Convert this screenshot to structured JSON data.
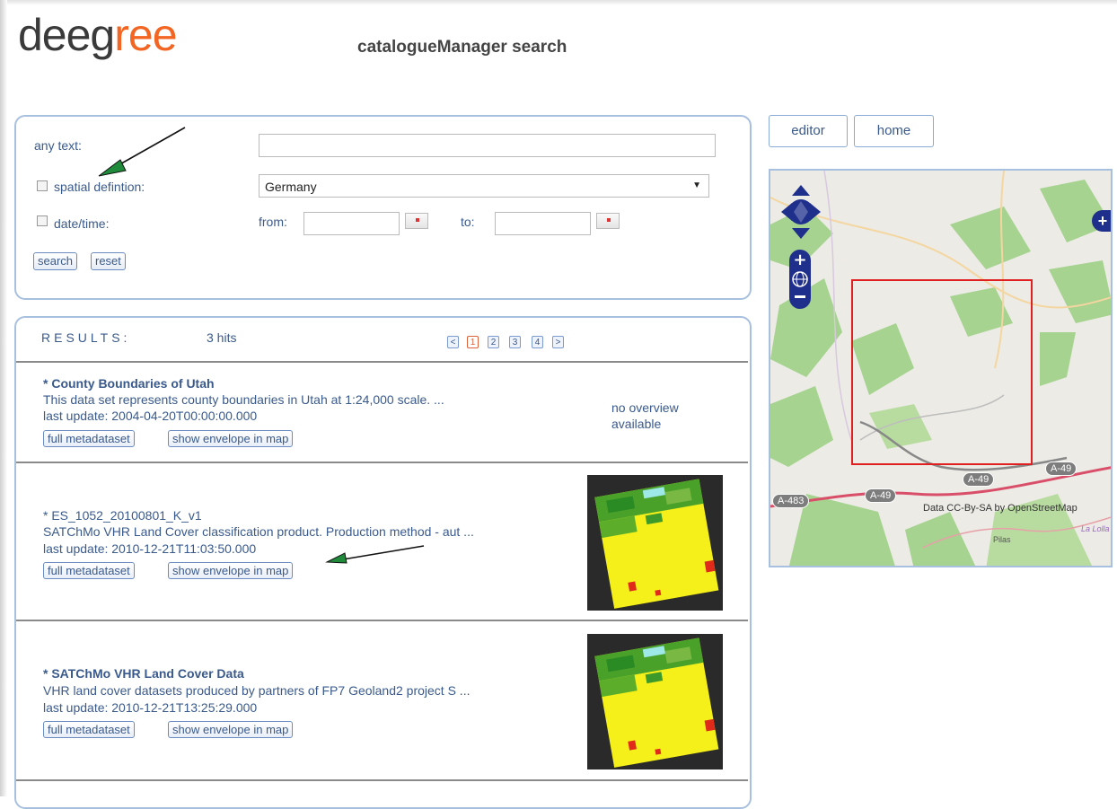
{
  "header": {
    "logo_main": "deeg",
    "logo_accent": "ree",
    "title": "catalogueManager search"
  },
  "search": {
    "any_text_label": "any text:",
    "any_text_value": "",
    "spatial_label": "spatial defintion:",
    "spatial_value": "Germany",
    "date_label": "date/time:",
    "from_label": "from:",
    "to_label": "to:",
    "search_button": "search",
    "reset_button": "reset"
  },
  "results": {
    "heading": "RESULTS:",
    "hits": "3 hits",
    "pager": {
      "prev": "<",
      "pages": [
        "1",
        "2",
        "3",
        "4"
      ],
      "next": ">",
      "active": "1"
    },
    "items": [
      {
        "title": "* County Boundaries of Utah",
        "desc": "This data set represents county boundaries in Utah at 1:24,000 scale. ...",
        "date": "last update: 2004-04-20T00:00:00.000",
        "full_btn": "full metadataset",
        "envelope_btn": "show envelope in map",
        "overview_line1": "no overview",
        "overview_line2": "available"
      },
      {
        "title": "* ES_1052_20100801_K_v1",
        "desc": "SATChMo VHR Land Cover classification product. Production method - aut ...",
        "date": "last update: 2010-12-21T11:03:50.000",
        "full_btn": "full metadataset",
        "envelope_btn": "show envelope in map"
      },
      {
        "title": "* SATChMo VHR Land Cover Data",
        "desc": "VHR land cover datasets produced by partners of FP7 Geoland2 project S ...",
        "date": "last update: 2010-12-21T13:25:29.000",
        "full_btn": "full metadataset",
        "envelope_btn": "show envelope in map"
      }
    ]
  },
  "nav": {
    "editor": "editor",
    "home": "home"
  },
  "map": {
    "attribution": "Data CC-By-SA by OpenStreetMap",
    "road_labels": [
      "A-49",
      "A-49",
      "A-49",
      "A-483"
    ],
    "place_labels": [
      "Pilas",
      "La Lolla"
    ],
    "envelope_color": "#e02020"
  },
  "colors": {
    "accent": "#f26522",
    "link": "#3a5a8c",
    "panel_border": "#a8c0e0"
  }
}
